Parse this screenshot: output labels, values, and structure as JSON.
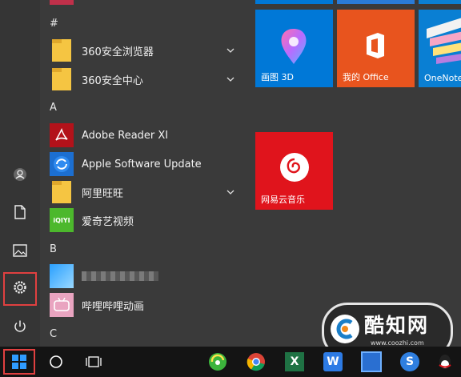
{
  "start_menu": {
    "left_rail": {
      "items": [
        {
          "name": "user",
          "icon": "user-icon"
        },
        {
          "name": "documents",
          "icon": "document-icon"
        },
        {
          "name": "pictures",
          "icon": "picture-icon"
        },
        {
          "name": "settings",
          "icon": "gear-icon",
          "highlighted": true
        },
        {
          "name": "power",
          "icon": "power-icon"
        }
      ]
    },
    "app_list": {
      "sections": [
        {
          "header": "#"
        },
        {
          "header": "A"
        },
        {
          "header": "B"
        },
        {
          "header": "C"
        }
      ],
      "items": [
        {
          "label": "360安全浏览器",
          "icon": "folder-icon",
          "expandable": true
        },
        {
          "label": "360安全中心",
          "icon": "folder-icon",
          "expandable": true
        },
        {
          "label": "Adobe Reader XI",
          "icon": "adobe-reader-icon",
          "expandable": false
        },
        {
          "label": "Apple Software Update",
          "icon": "apple-update-icon",
          "expandable": false
        },
        {
          "label": "阿里旺旺",
          "icon": "folder-icon",
          "expandable": true
        },
        {
          "label": "爱奇艺视频",
          "icon": "iqiyi-icon",
          "icon_text": "iQIYI",
          "expandable": false
        },
        {
          "label": "",
          "icon": "blurred-app-icon",
          "blurred": true,
          "expandable": false
        },
        {
          "label": "哔哩哔哩动画",
          "icon": "bilibili-icon",
          "expandable": false
        }
      ]
    },
    "tiles": [
      {
        "label": "画图 3D",
        "color": "#0078d7",
        "icon": "paint3d-icon"
      },
      {
        "label": "我的 Office",
        "color": "#e8541e",
        "icon": "office-icon"
      },
      {
        "label": "OneNote",
        "color": "#0a7fd3",
        "icon": "onenote-icon"
      },
      {
        "label": "网易云音乐",
        "color": "#e0141c",
        "icon": "netease-music-icon"
      }
    ],
    "highlight_color": "#e04040"
  },
  "taskbar": {
    "items": [
      {
        "name": "start",
        "icon": "windows-icon",
        "highlighted": true
      },
      {
        "name": "search",
        "icon": "cortana-circle-icon"
      },
      {
        "name": "task-view",
        "icon": "task-view-icon"
      },
      {
        "name": "360-browser",
        "icon": "360-browser-icon"
      },
      {
        "name": "chrome",
        "icon": "chrome-icon"
      },
      {
        "name": "excel",
        "icon": "excel-icon",
        "icon_text": "X"
      },
      {
        "name": "app-w",
        "icon": "w-app-icon",
        "icon_text": "W"
      },
      {
        "name": "app-5",
        "icon": "app-icon"
      },
      {
        "name": "sogou",
        "icon": "sogou-icon",
        "icon_text": "S"
      },
      {
        "name": "qq",
        "icon": "qq-icon"
      }
    ]
  },
  "watermark": {
    "name": "酷知网",
    "url": "www.coozhi.com",
    "icon": "coozhi-logo-icon"
  }
}
